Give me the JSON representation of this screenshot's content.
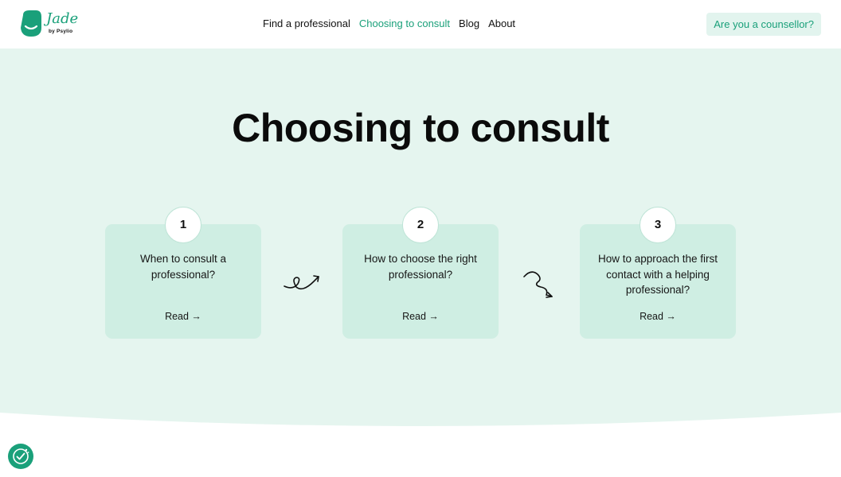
{
  "header": {
    "logo_name": "Jade",
    "logo_by": "by Psylio",
    "nav": [
      {
        "label": "Find a professional",
        "active": false
      },
      {
        "label": "Choosing to consult",
        "active": true
      },
      {
        "label": "Blog",
        "active": false
      },
      {
        "label": "About",
        "active": false
      }
    ],
    "cta_label": "Are you a counsellor?"
  },
  "hero": {
    "title": "Choosing to consult",
    "steps": [
      {
        "number": "1",
        "title": "When to consult a professional?",
        "link": "Read →"
      },
      {
        "number": "2",
        "title": "How to choose the right professional?",
        "link": "Read →"
      },
      {
        "number": "3",
        "title": "How to approach the first contact with a helping professional?",
        "link": "Read →"
      }
    ]
  },
  "colors": {
    "brand": "#1aa07a",
    "hero_bg": "#e5f5ef",
    "card_bg": "#cfeee3",
    "cta_bg": "#e2f4ee"
  },
  "icons": {
    "logo": "jade-face-icon",
    "squiggle_1": "loop-arrow-icon",
    "squiggle_2": "wave-arrow-icon",
    "floating_button": "cookie-consent-icon"
  }
}
